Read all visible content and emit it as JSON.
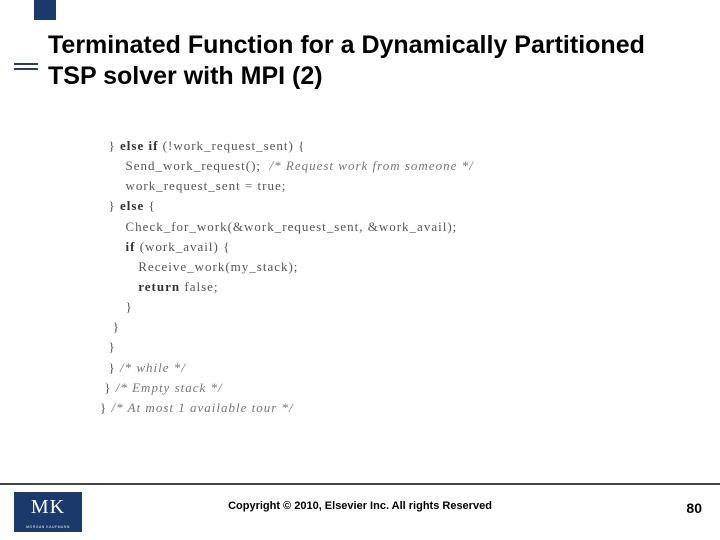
{
  "title": "Terminated Function for a Dynamically Partitioned TSP solver with MPI (2)",
  "code": {
    "l1a": "  } ",
    "l1b": "else if",
    "l1c": " (!work_request_sent) {",
    "l2a": "      Send_work_request();  ",
    "l2b": "/* Request work from someone */",
    "l3": "      work_request_sent = true;",
    "l4a": "  } ",
    "l4b": "else",
    "l4c": " {",
    "l5": "      Check_for_work(&work_request_sent, &work_avail);",
    "l6a": "      ",
    "l6b": "if",
    "l6c": " (work_avail) {",
    "l7": "         Receive_work(my_stack);",
    "l8a": "         ",
    "l8b": "return",
    "l8c": " false;",
    "l9": "      }",
    "l10": "   }",
    "l11": "  }",
    "l12a": "  } ",
    "l12b": "/* while */",
    "l13a": " } ",
    "l13b": "/* Empty stack */",
    "l14a": "} ",
    "l14b": "/* At most 1 available tour */"
  },
  "logo": {
    "main": "MK",
    "sub": "MORGAN KAUFMANN"
  },
  "copyright": "Copyright © 2010, Elsevier Inc. All rights Reserved",
  "pagenum": "80"
}
